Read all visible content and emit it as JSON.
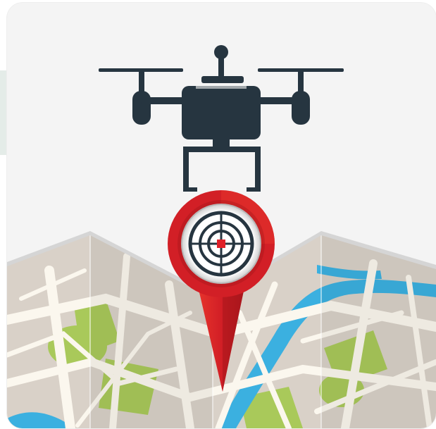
{
  "illustration": {
    "subject": "drone-delivery-map-pin",
    "colors": {
      "card_background": "#f4f4f4",
      "drone": "#263540",
      "pin_red": "#d21f26",
      "pin_dark_red": "#a8161c",
      "map_base": "#d9d1c8",
      "map_road": "#fbf7ee",
      "map_park": "#a9c95a",
      "map_water": "#3bb0e0",
      "map_fold_top": "#d5d5d5"
    },
    "icons": [
      "drone-icon",
      "map-icon",
      "location-pin-icon",
      "crosshair-target-icon"
    ]
  }
}
